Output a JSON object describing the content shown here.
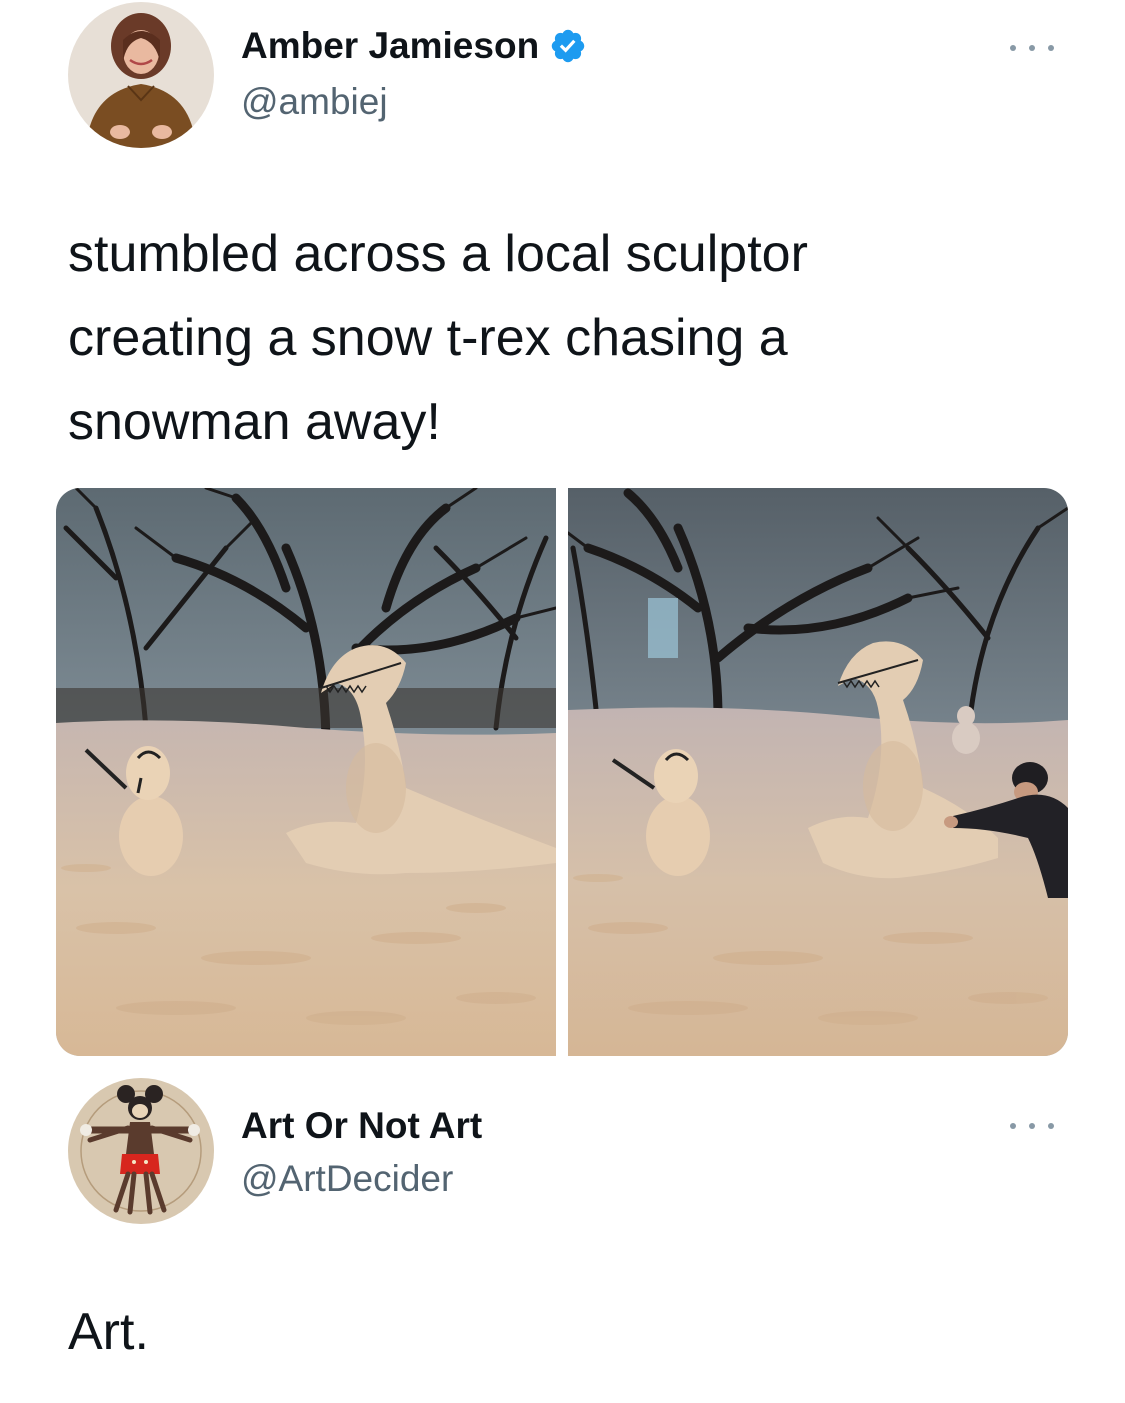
{
  "tweet1": {
    "author": {
      "name": "Amber Jamieson",
      "handle": "@ambiej",
      "verified": true
    },
    "text_lines": [
      "stumbled across a local sculptor",
      "creating a snow t-rex chasing a",
      "snowman away!"
    ],
    "media": [
      {
        "icon": "photo-snow-trex-chasing-snowman"
      },
      {
        "icon": "photo-sculptor-working-on-snow-trex"
      }
    ]
  },
  "tweet2": {
    "author": {
      "name": "Art Or Not Art",
      "handle": "@ArtDecider"
    },
    "text": "Art."
  },
  "colors": {
    "verified_badge": "#1d9bf0",
    "handle": "#536471",
    "text": "#0f1419",
    "more_dots": "#8899a6"
  }
}
